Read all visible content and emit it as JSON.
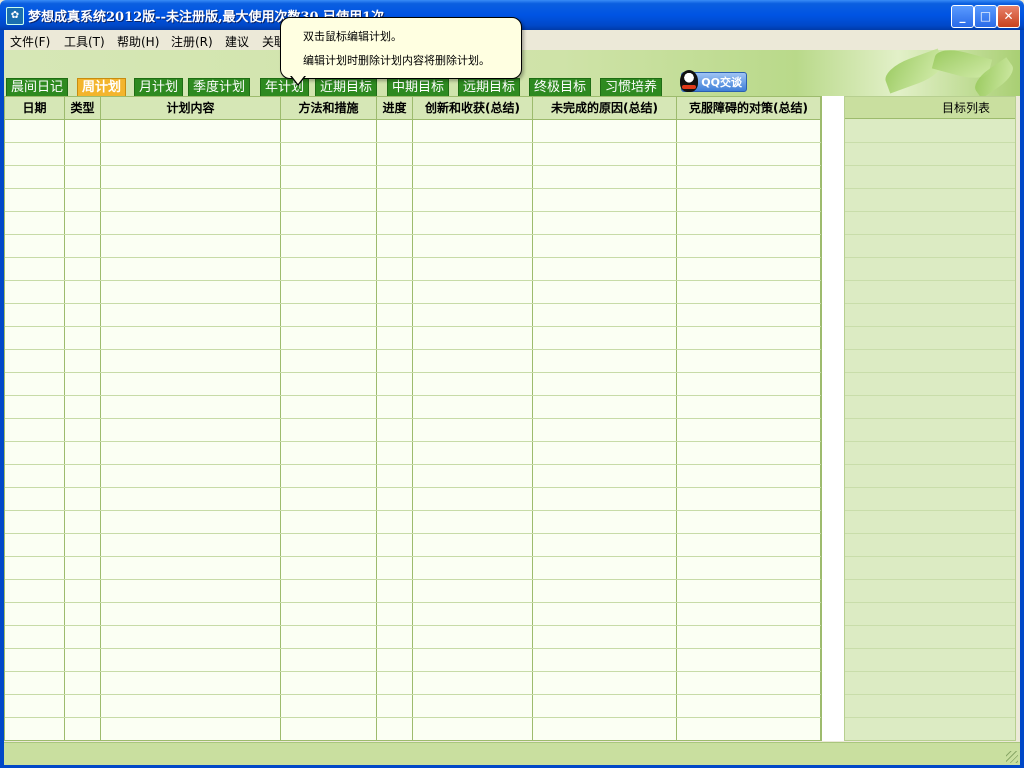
{
  "window": {
    "title": "梦想成真系统2012版--未注册版,最大使用次数30,已使用1次",
    "minimize": "_",
    "maximize": "□",
    "close": "✕"
  },
  "menu": [
    "文件(F)",
    "工具(T)",
    "帮助(H)",
    "注册(R)",
    "建议",
    "关联"
  ],
  "tabs": [
    "晨间日记",
    "周计划",
    "月计划",
    "季度计划",
    "年计划",
    "近期目标",
    "中期目标",
    "远期目标",
    "终极目标",
    "习惯培养"
  ],
  "active_tab": "周计划",
  "qq_button": "QQ交谈",
  "tooltip": {
    "line1": "双击鼠标编辑计划。",
    "line2": "编辑计划时删除计划内容将删除计划。"
  },
  "table": {
    "columns": [
      "日期",
      "类型",
      "计划内容",
      "方法和措施",
      "进度",
      "创新和收获(总结)",
      "未完成的原因(总结)",
      "克服障碍的对策(总结)"
    ],
    "rows": []
  },
  "side_panel": {
    "header": "目标列表",
    "items": []
  },
  "colors": {
    "tab_green": "#2e8a20",
    "tab_active": "#f3b52d",
    "grid_header": "#d6e7b6",
    "side_panel": "#dcebc3",
    "titlebar": "#0054e3"
  }
}
